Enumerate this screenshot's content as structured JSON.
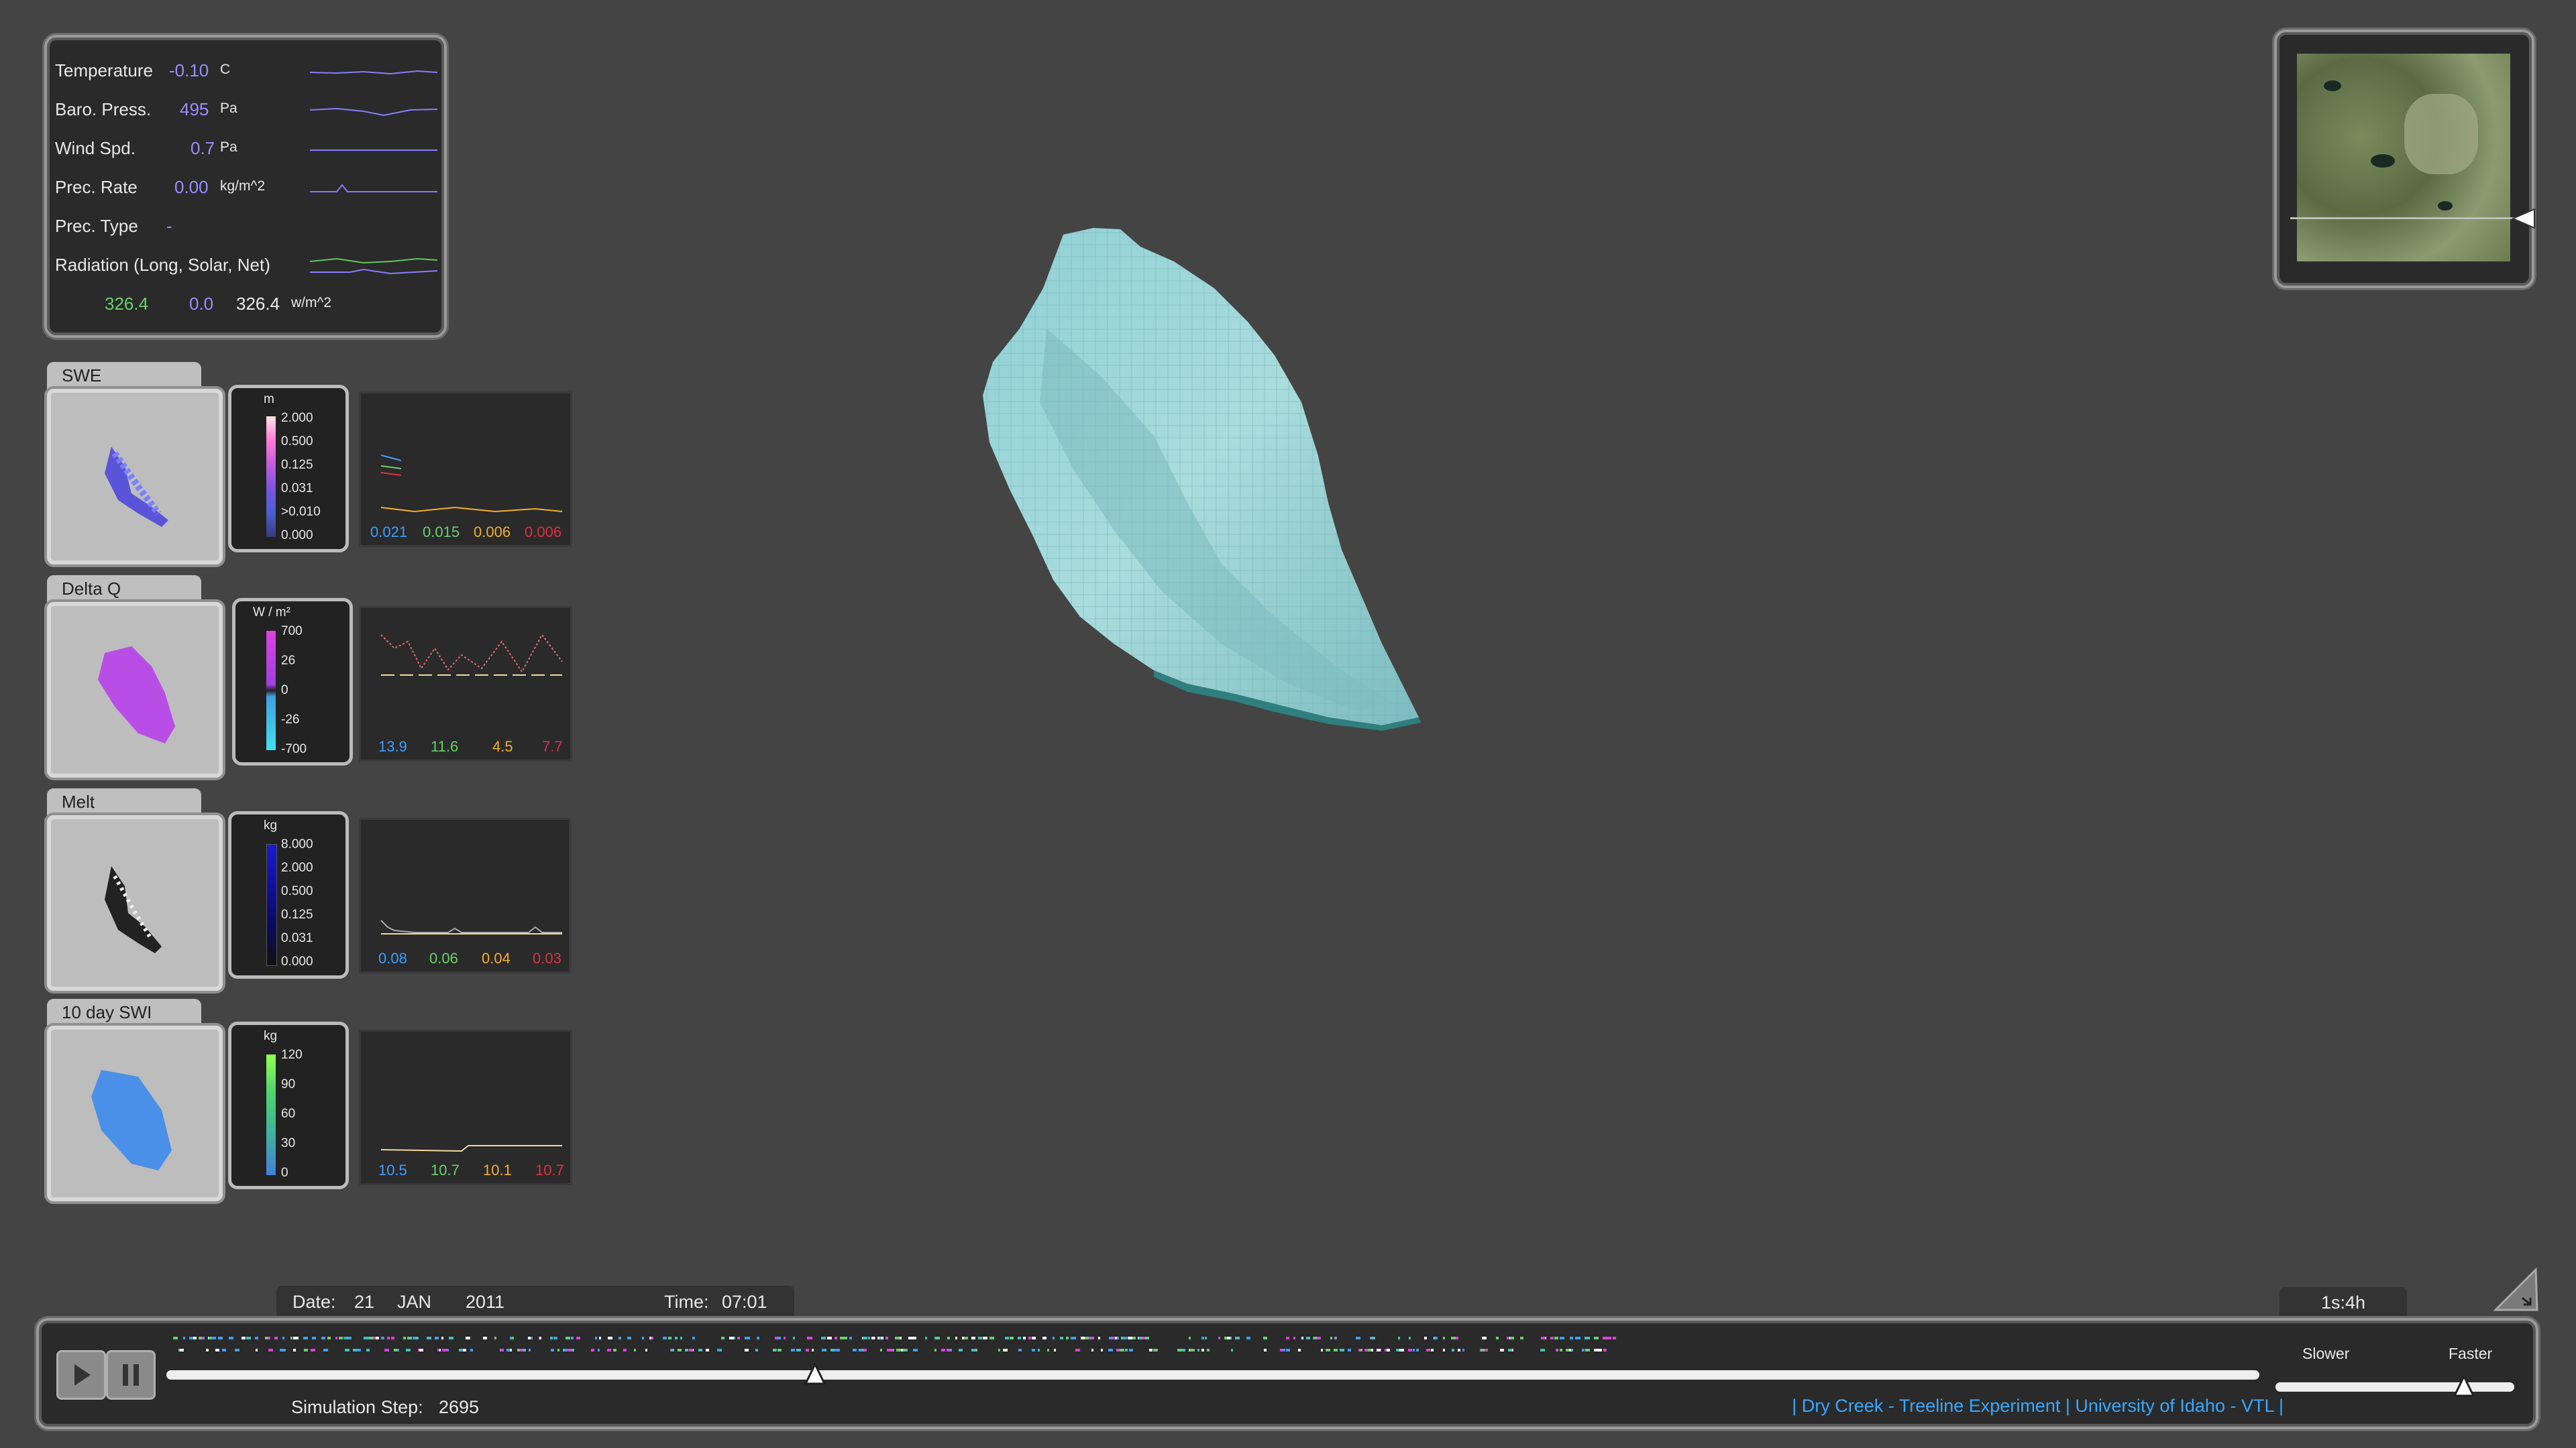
{
  "weather": {
    "rows": [
      {
        "label": "Temperature",
        "value": "-0.10",
        "unit": "C"
      },
      {
        "label": "Baro. Press.",
        "value": "495",
        "unit": "Pa"
      },
      {
        "label": "Wind Spd.",
        "value": "0.7",
        "unit": "Pa"
      },
      {
        "label": "Prec. Rate",
        "value": "0.00",
        "unit": "kg/m^2"
      },
      {
        "label": "Prec. Type",
        "value": "-",
        "unit": ""
      },
      {
        "label": "Radiation (Long, Solar, Net)",
        "value": "",
        "unit": ""
      }
    ],
    "radiation": {
      "long": "326.4",
      "solar": "0.0",
      "net": "326.4",
      "unit": "w/m^2"
    }
  },
  "panels": [
    {
      "title": "SWE",
      "unit": "m",
      "ticks": [
        "2.000",
        "0.500",
        "0.125",
        "0.031",
        ">0.010",
        "0.000"
      ],
      "values": [
        "0.021",
        "0.015",
        "0.006",
        "0.006"
      ]
    },
    {
      "title": "Delta Q",
      "unit": "W / m²",
      "ticks": [
        "700",
        "26",
        "0",
        "-26",
        "-700"
      ],
      "values": [
        "13.9",
        "11.6",
        "4.5",
        "7.7"
      ]
    },
    {
      "title": "Melt",
      "unit": "kg",
      "ticks": [
        "8.000",
        "2.000",
        "0.500",
        "0.125",
        "0.031",
        "0.000"
      ],
      "values": [
        "0.08",
        "0.06",
        "0.04",
        "0.03"
      ]
    },
    {
      "title": "10 day SWI",
      "unit": "kg",
      "ticks": [
        "120",
        "90",
        "60",
        "30",
        "0"
      ],
      "values": [
        "10.5",
        "10.7",
        "10.1",
        "10.7"
      ]
    }
  ],
  "value_colors": [
    "#3aa0ff",
    "#6ad06a",
    "#f0b030",
    "#e03040"
  ],
  "date": {
    "label": "Date:",
    "day": "21",
    "month": "JAN",
    "year": "2011"
  },
  "time": {
    "label": "Time:",
    "value": "07:01"
  },
  "speed": "1s:4h",
  "step": {
    "label": "Simulation Step:",
    "value": "2695"
  },
  "timeline_progress": 0.31,
  "speed_slider": {
    "slower": "Slower",
    "faster": "Faster",
    "level": 0.79
  },
  "credits": "| Dry Creek - Treeline Experiment | University of Idaho - VTL |",
  "icons": {
    "play": "play-icon",
    "pause": "pause-icon",
    "world": "world-icon"
  }
}
